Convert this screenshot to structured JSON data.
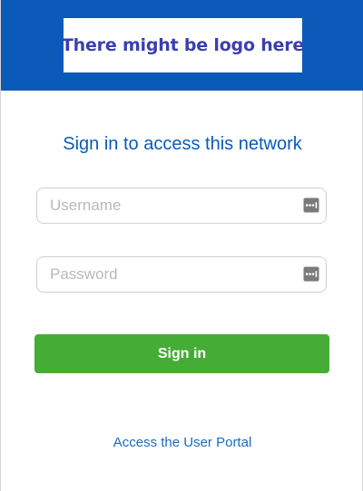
{
  "header": {
    "logo_text": "There might be logo here",
    "background_color": "#0b5ab9"
  },
  "form": {
    "title": "Sign in to access this network",
    "username": {
      "placeholder": "Username",
      "value": "",
      "icon": "password-manager-icon"
    },
    "password": {
      "placeholder": "Password",
      "value": "",
      "icon": "password-manager-icon"
    },
    "submit_label": "Sign in",
    "submit_color": "#45ad35"
  },
  "footer": {
    "portal_link": "Access the User Portal"
  }
}
